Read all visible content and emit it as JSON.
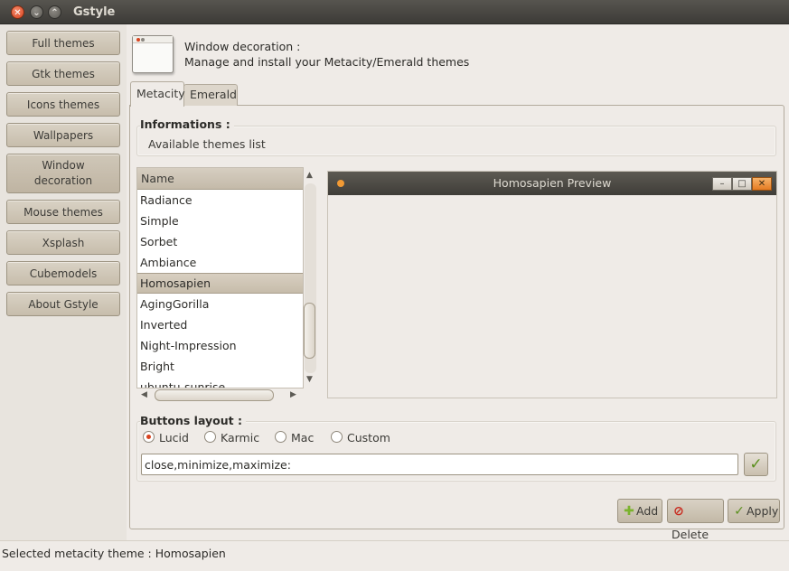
{
  "window": {
    "title": "Gstyle",
    "close_glyph": "✕",
    "min_glyph": "⌄",
    "max_glyph": "⌃"
  },
  "sidebar": {
    "items": [
      {
        "label": "Full themes"
      },
      {
        "label": "Gtk themes"
      },
      {
        "label": "Icons themes"
      },
      {
        "label": "Wallpapers"
      },
      {
        "label": "Window decoration",
        "line1": "Window",
        "line2": "decoration"
      },
      {
        "label": "Mouse themes"
      },
      {
        "label": "Xsplash"
      },
      {
        "label": "Cubemodels"
      },
      {
        "label": "About Gstyle"
      }
    ]
  },
  "header": {
    "title": "Window decoration :",
    "description": "Manage and install your Metacity/Emerald themes",
    "icon": "window-icon"
  },
  "tabs": [
    {
      "label": "Metacity",
      "active": true
    },
    {
      "label": "Emerald",
      "active": false
    }
  ],
  "informations": {
    "title": "Informations :",
    "text": "Available themes list"
  },
  "theme_list": {
    "header": "Name",
    "rows": [
      "Radiance",
      "Simple",
      "Sorbet",
      "Ambiance",
      "Homosapien",
      "AgingGorilla",
      "Inverted",
      "Night-Impression",
      "Bright",
      "ubuntu-sunrise"
    ],
    "selected": "Homosapien"
  },
  "scroll": {
    "up": "▲",
    "down": "▼",
    "left": "◀",
    "right": "▶"
  },
  "preview": {
    "title": "Homosapien Preview",
    "min_glyph": "–",
    "max_glyph": "□",
    "close_glyph": "✕"
  },
  "buttons_layout": {
    "title": "Buttons layout :",
    "options": [
      {
        "label": "Lucid",
        "selected": true
      },
      {
        "label": "Karmic",
        "selected": false
      },
      {
        "label": "Mac",
        "selected": false
      },
      {
        "label": "Custom",
        "selected": false
      }
    ],
    "value": "close,minimize,maximize:",
    "apply_glyph": "✓"
  },
  "actions": {
    "add": {
      "label": "Add",
      "glyph": "✚"
    },
    "delete": {
      "label": "Delete",
      "glyph": "⊘"
    },
    "apply": {
      "label": "Apply",
      "glyph": "✓"
    }
  },
  "status": "Selected metacity theme : Homosapien",
  "colors": {
    "accent": "#d8431f",
    "titlebar": "#3c3b37",
    "button": "#c7bdac",
    "add_icon": "#7bb32e",
    "delete_icon": "#c92a1e",
    "apply_icon": "#5a8f1c"
  }
}
